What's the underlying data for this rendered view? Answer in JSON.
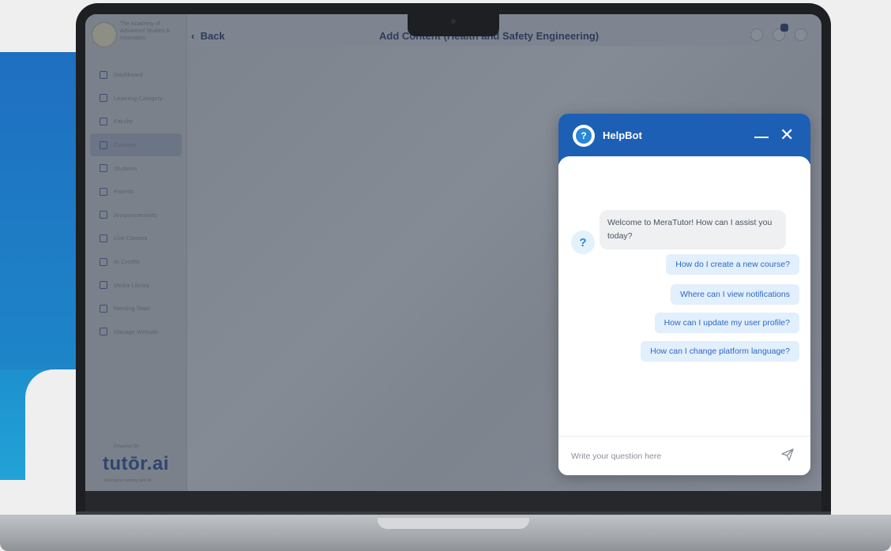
{
  "app": {
    "org_name": "The Academy of Advanced Studies & Innovation",
    "back_label": "Back",
    "page_title": "Add Content (Health and Safety Engineering)",
    "notification_count": ""
  },
  "sidebar": {
    "items": [
      {
        "label": "Dashboard",
        "icon": "dashboard-icon"
      },
      {
        "label": "Learning Category",
        "icon": "category-icon"
      },
      {
        "label": "Faculty",
        "icon": "user-icon"
      },
      {
        "label": "Courses",
        "icon": "courses-icon",
        "active": true
      },
      {
        "label": "Students",
        "icon": "students-icon"
      },
      {
        "label": "Parents",
        "icon": "parents-icon"
      },
      {
        "label": "Announcements",
        "icon": "megaphone-icon"
      },
      {
        "label": "Live Classes",
        "icon": "video-icon"
      },
      {
        "label": "AI Credits",
        "icon": "credits-icon"
      },
      {
        "label": "Media Library",
        "icon": "media-icon"
      },
      {
        "label": "Meeting Stats",
        "icon": "stats-icon"
      },
      {
        "label": "Manage Website",
        "icon": "website-icon"
      }
    ],
    "powered_by": "Powered By",
    "brand": "tutōr.ai",
    "brand_tagline": "Reimagine learning with AI"
  },
  "helpbot": {
    "title": "HelpBot",
    "welcome": "Welcome to MeraTutor! How can I assist you today?",
    "suggestions": [
      "How do I create a new course?",
      "Where can I view notifications",
      "How can I update my user profile?",
      "How can I change platform language?"
    ],
    "input_placeholder": "Write your question here",
    "colors": {
      "header": "#1d5fb4",
      "suggestion_bg": "#e2effc",
      "suggestion_text": "#2d68c4"
    }
  }
}
